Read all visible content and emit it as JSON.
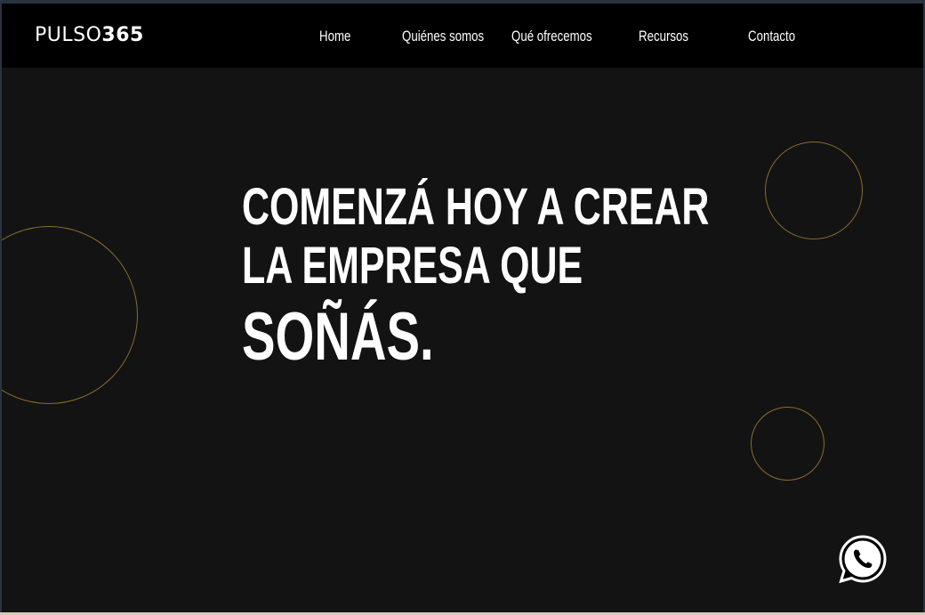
{
  "header": {
    "logo": {
      "light": "PULSO",
      "bold": "365"
    },
    "nav": [
      {
        "label": "Home"
      },
      {
        "label": "Quiénes somos"
      },
      {
        "label": "Qué ofrecemos"
      },
      {
        "label": "Recursos"
      },
      {
        "label": "Contacto"
      }
    ]
  },
  "hero": {
    "line1": "COMENZÁ HOY A CREAR",
    "line2": "LA EMPRESA QUE",
    "line3": "SOÑÁS."
  },
  "colors": {
    "background": "#131313",
    "header": "#000000",
    "accent_circle": "#8a6b2a",
    "text": "#ffffff"
  },
  "icons": {
    "whatsapp": "whatsapp-icon"
  }
}
